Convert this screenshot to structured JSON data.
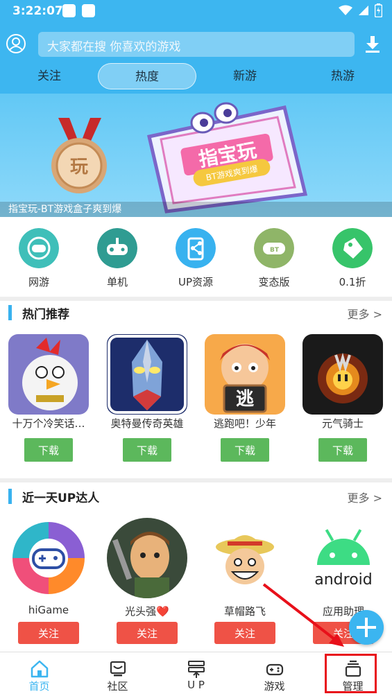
{
  "status": {
    "time": "3:22:07"
  },
  "search": {
    "placeholder": "大家都在搜  你喜欢的游戏"
  },
  "tabs": [
    {
      "label": "关注"
    },
    {
      "label": "热度",
      "active": true
    },
    {
      "label": "新游"
    },
    {
      "label": "热游"
    }
  ],
  "banner": {
    "caption": "指宝玩-BT游戏盒子爽到爆",
    "sign_title": "指宝玩",
    "sign_sub": "BT游戏爽到爆",
    "medal_text": "玩"
  },
  "categories": [
    {
      "label": "网游",
      "icon": "gamepad-globe-icon",
      "color": "#3fbfb9"
    },
    {
      "label": "单机",
      "icon": "gamepad-icon",
      "color": "#2f9c92"
    },
    {
      "label": "UP资源",
      "icon": "share-phone-icon",
      "color": "#38b2ef"
    },
    {
      "label": "变态版",
      "icon": "bt-gamepad-icon",
      "color": "#8fb568"
    },
    {
      "label": "0.1折",
      "icon": "discount-tag-icon",
      "color": "#37c46a"
    }
  ],
  "hot": {
    "title": "热门推荐",
    "more": "更多 >",
    "download_label": "下载",
    "games": [
      {
        "name": "十万个冷笑话…",
        "icon": "rooster-game-icon"
      },
      {
        "name": "奥特曼传奇英雄",
        "icon": "ultraman-game-icon"
      },
      {
        "name": "逃跑吧！少年",
        "icon": "escape-boy-game-icon",
        "sign": "逃"
      },
      {
        "name": "元气骑士",
        "icon": "soul-knight-game-icon"
      }
    ]
  },
  "up": {
    "title": "近一天UP达人",
    "more": "更多 >",
    "follow_label": "关注",
    "users": [
      {
        "name": "hiGame",
        "icon": "higame-avatar-icon"
      },
      {
        "name": "光头强❤️",
        "icon": "bald-man-avatar-icon"
      },
      {
        "name": "草帽路飞",
        "icon": "luffy-avatar-icon"
      },
      {
        "name": "应用助理",
        "icon": "android-avatar-icon",
        "logo_text": "android"
      }
    ]
  },
  "nav": [
    {
      "label": "首页",
      "icon": "home-icon",
      "active": true
    },
    {
      "label": "社区",
      "icon": "community-icon"
    },
    {
      "label": "U P",
      "icon": "up-server-icon"
    },
    {
      "label": "游戏",
      "icon": "gamepad-nav-icon"
    },
    {
      "label": "管理",
      "icon": "manage-icon"
    }
  ],
  "colors": {
    "accent": "#3bb5f0",
    "download_green": "#5cb85c",
    "follow_red": "#ef5246",
    "annotation_red": "#e8101a"
  }
}
